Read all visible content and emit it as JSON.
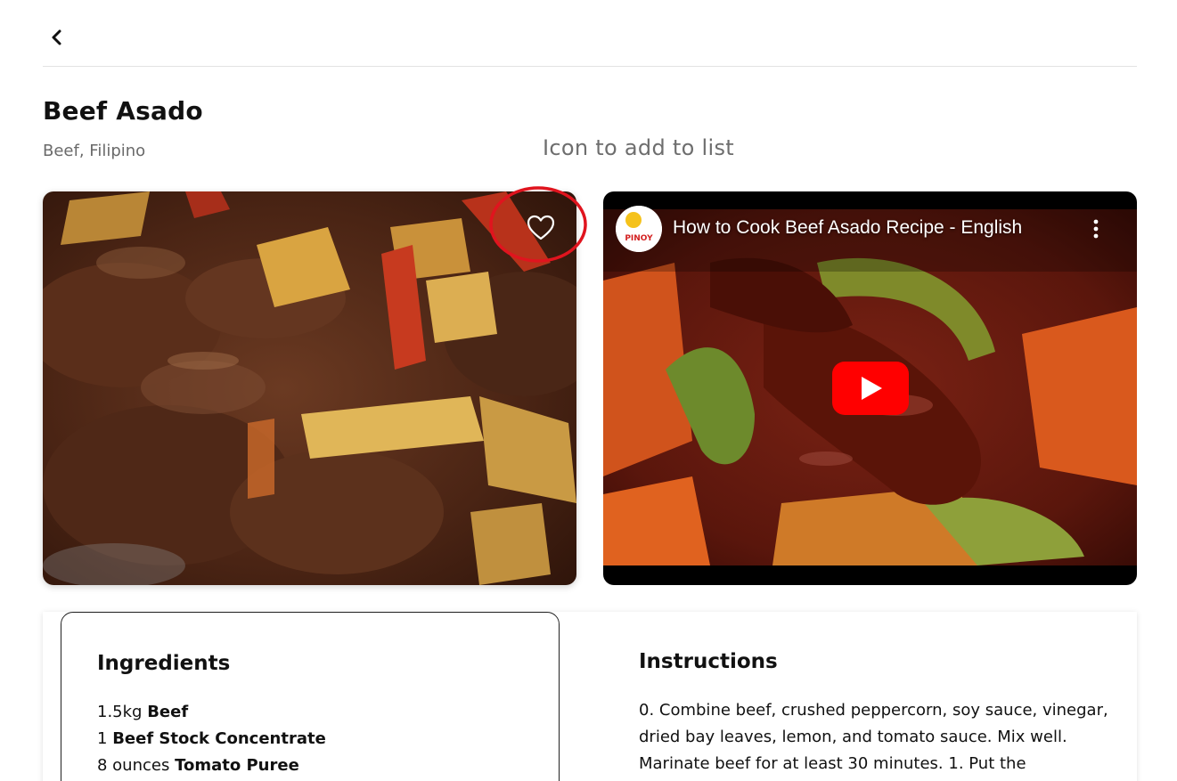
{
  "recipe": {
    "title": "Beef Asado",
    "tags": "Beef, Filipino"
  },
  "annotation": {
    "text": "Icon to add to list",
    "ring_color": "#e0141e"
  },
  "icons": {
    "back": "chevron-left-icon",
    "favorite": "heart-outline-icon",
    "play": "youtube-play-icon",
    "more": "more-vertical-icon"
  },
  "video": {
    "title": "How to Cook Beef Asado Recipe - English",
    "channel_avatar_text": "PINOY",
    "play_color": "#ff0000"
  },
  "ingredients": {
    "title": "Ingredients",
    "items": [
      {
        "qty": "1.5kg ",
        "name": "Beef"
      },
      {
        "qty": "1 ",
        "name": "Beef Stock Concentrate"
      },
      {
        "qty": "8 ounces ",
        "name": "Tomato Puree"
      }
    ]
  },
  "instructions": {
    "title": "Instructions",
    "text": "0. Combine beef, crushed peppercorn, soy sauce, vinegar, dried bay leaves, lemon, and tomato sauce. Mix well. Marinate beef for at least 30 minutes. 1. Put the"
  }
}
